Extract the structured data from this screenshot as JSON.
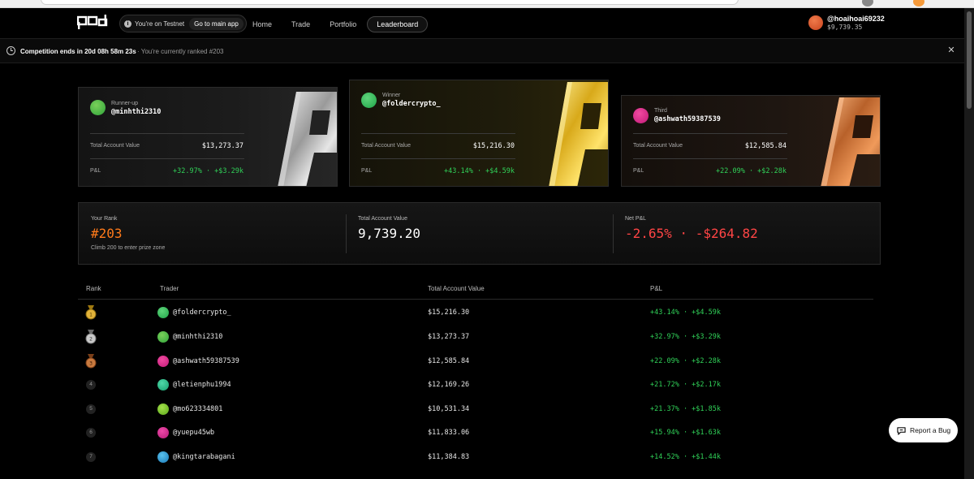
{
  "nav": {
    "testnet_text": "You're on Testnet",
    "go_main": "Go to main app",
    "links": [
      "Home",
      "Trade",
      "Portfolio",
      "Leaderboard"
    ],
    "active": "Leaderboard",
    "account_name": "@hoaihoai69232",
    "account_balance": "$9,739.35"
  },
  "banner": {
    "countdown": "Competition ends in 20d 08h 58m 23s",
    "rank_text": "You're currently ranked #203"
  },
  "podium": [
    {
      "place": "Runner-up",
      "handle": "@minhthi2310",
      "tav_label": "Total Account Value",
      "tav": "$13,273.37",
      "pnl_label": "P&L",
      "pnl": "+32.97% · +$3.29k",
      "avatar_color": "#49c24a"
    },
    {
      "place": "Winner",
      "handle": "@foldercrypto_",
      "tav_label": "Total Account Value",
      "tav": "$15,216.30",
      "pnl_label": "P&L",
      "pnl": "+43.14% · +$4.59k",
      "avatar_color": "#32c45c"
    },
    {
      "place": "Third",
      "handle": "@ashwath59387539",
      "tav_label": "Total Account Value",
      "tav": "$12,585.84",
      "pnl_label": "P&L",
      "pnl": "+22.09% · +$2.28k",
      "avatar_color": "#e0318f"
    }
  ],
  "stats": {
    "rank_label": "Your Rank",
    "rank": "#203",
    "rank_sub": "Climb 200 to enter prize zone",
    "tav_label": "Total Account Value",
    "tav": "9,739.20",
    "pnl_label": "Net P&L",
    "pnl": "-2.65% · -$264.82"
  },
  "table": {
    "headers": [
      "Rank",
      "Trader",
      "Total Account Value",
      "P&L"
    ],
    "rows": [
      {
        "rank": "1",
        "trader": "@foldercrypto_",
        "tav": "$15,216.30",
        "pnl": "+43.14% · +$4.59k",
        "color": "#32c45c"
      },
      {
        "rank": "2",
        "trader": "@minhthi2310",
        "tav": "$13,273.37",
        "pnl": "+32.97% · +$3.29k",
        "color": "#49c24a"
      },
      {
        "rank": "3",
        "trader": "@ashwath59387539",
        "tav": "$12,585.84",
        "pnl": "+22.09% · +$2.28k",
        "color": "#e0318f"
      },
      {
        "rank": "4",
        "trader": "@letienphu1994",
        "tav": "$12,169.26",
        "pnl": "+21.72% · +$2.17k",
        "color": "#2fc08f"
      },
      {
        "rank": "5",
        "trader": "@mo623334801",
        "tav": "$10,531.34",
        "pnl": "+21.37% · +$1.85k",
        "color": "#7cc52a"
      },
      {
        "rank": "6",
        "trader": "@yuepu45wb",
        "tav": "$11,833.06",
        "pnl": "+15.94% · +$1.63k",
        "color": "#d8318f"
      },
      {
        "rank": "7",
        "trader": "@kingtarabagani",
        "tav": "$11,384.83",
        "pnl": "+14.52% · +$1.44k",
        "color": "#2b9fd8"
      }
    ]
  },
  "bug_button": "Report a Bug"
}
